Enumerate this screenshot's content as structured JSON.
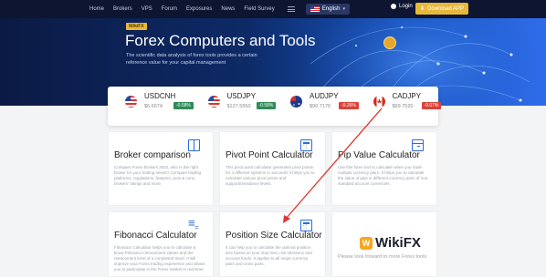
{
  "header": {
    "nav": [
      "Home",
      "Brokers",
      "VPS",
      "Forum",
      "Exposures",
      "News",
      "Field Survey"
    ],
    "language": "English",
    "login": "Login",
    "download": "Download APP"
  },
  "hero": {
    "badge": "WikiFX",
    "title": "Forex Computers and Tools",
    "subtitle": "The scientific data analysis of forex tools provides a certain reference value for your capital management"
  },
  "ticker": [
    {
      "symbol": "USDCNH",
      "price": "$6.6674",
      "change": "-0.58%",
      "color": "#2e8b57"
    },
    {
      "symbol": "USDJPY",
      "price": "$127.5550",
      "change": "-0.58%",
      "color": "#2e8b57"
    },
    {
      "symbol": "AUDJPY",
      "price": "$90.7170",
      "change": "-0.26%",
      "color": "#d9443a"
    },
    {
      "symbol": "CADJPY",
      "price": "$99.7520",
      "change": "-0.07%",
      "color": "#d9443a"
    }
  ],
  "cards": {
    "broker": {
      "title": "Broker comparison",
      "desc": "Compare Forex Brokers 2022, who is the right broker for your trading needs? Compare trading platforms, regulations, features, pros & cons, brokers' ratings and more."
    },
    "pivot": {
      "title": "Pivot Point Calculator",
      "desc": "This pivot point calculator generates pivot points for 4 different systems in seconds! It helps you to calculate various pivot points and support/resistance levels."
    },
    "pip": {
      "title": "Pip Value Calculator",
      "desc": "Use this forex tool to calculate when you trade multiple currency pairs. It helps you to calculate the value of pips in different currency pairs of non-standard account currencies."
    },
    "fib": {
      "title": "Fibonacci Calculator",
      "desc": "Fibonacci Calculator helps you to calculate & know Fibonacci retracement values and the retracement level of a completed trend. It will improve your Forex trading experience and allows you to participate in the Forex market in real time."
    },
    "position": {
      "title": "Position Size Calculator",
      "desc": "It can help you to calculate the optimal position size based on your stop loss, risk tolerance and account funds. It applies to all major currency pairs and cross pairs."
    },
    "wikifx": {
      "name": "WikiFX",
      "text": "Please look forward to more Forex tools"
    }
  }
}
